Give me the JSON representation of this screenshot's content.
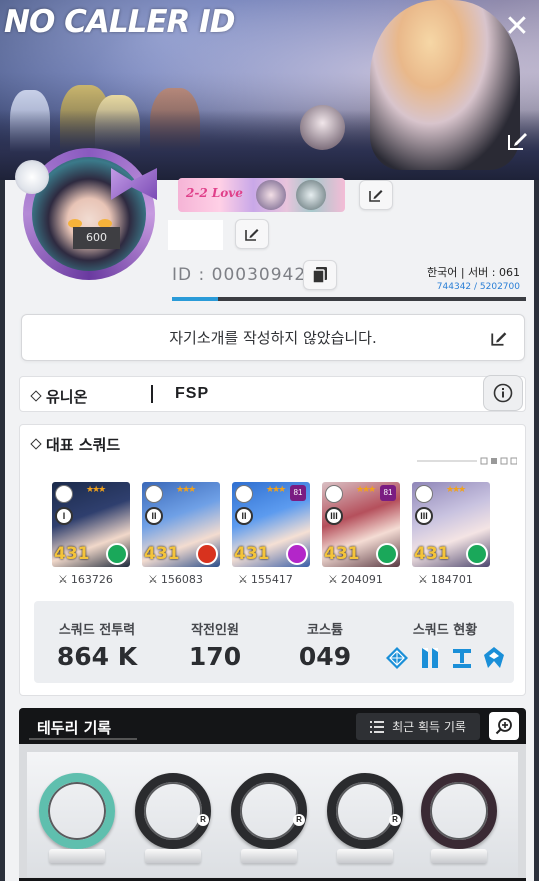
{
  "banner": {
    "title": "NO CALLER ID"
  },
  "profile": {
    "level": "600",
    "title_badge_text": "2-2 Love",
    "id_text": "ID : 00030942",
    "region_server": "한국어 | 서버 : 061",
    "server_count": "744342 / 5202700",
    "id_progress": 0.13,
    "intro_placeholder": "자기소개를 작성하지 않았습니다."
  },
  "union": {
    "label": "유니온",
    "name": "FSP"
  },
  "squad": {
    "label": "대표 스쿼드",
    "cards": [
      {
        "rank": "I",
        "level": "431",
        "elem_color": "#1aa85a",
        "power": "163726",
        "art": "linear-gradient(160deg,#1b2a4a 0%,#2f3f6e 40%,#f1d8ca 70%,#1e2a3c 100%)",
        "tag": ""
      },
      {
        "rank": "II",
        "level": "431",
        "elem_color": "#d8321e",
        "power": "156083",
        "art": "linear-gradient(160deg,#3a68b8 0%,#6fa0e6 40%,#f3dcd0 70%,#2c4e8a 100%)",
        "tag": ""
      },
      {
        "rank": "II",
        "level": "431",
        "elem_color": "#b326c9",
        "power": "155417",
        "art": "linear-gradient(160deg,#2f6fd0 0%,#5c9bef 40%,#f5e0d4 68%,#3b5fa8 100%)",
        "tag": "81"
      },
      {
        "rank": "III",
        "level": "431",
        "elem_color": "#1aa85a",
        "power": "204091",
        "art": "linear-gradient(160deg,#d9c0c4 0%,#b5505c 40%,#f4dcd4 65%,#5a3a44 100%)",
        "tag": "81"
      },
      {
        "rank": "III",
        "level": "431",
        "elem_color": "#1aa85a",
        "power": "184701",
        "art": "linear-gradient(160deg,#8f86b8 0%,#c9c3e0 40%,#f4e4e4 65%,#4e4870 100%)",
        "tag": ""
      }
    ],
    "stats": {
      "power_label": "스쿼드 전투력",
      "power_value": "864 K",
      "ops_label": "작전인원",
      "ops_value": "170",
      "costume_label": "코스튬",
      "costume_value": "049",
      "status_label": "스쿼드 현황"
    },
    "status_icons": [
      "diamond-grid-icon",
      "dual-bar-icon",
      "t-bar-icon",
      "crest-icon"
    ],
    "accent": "#1a8fd8"
  },
  "records": {
    "title": "테두리 기록",
    "recent_label": "최근 획득 기록",
    "rings": [
      {
        "name": "jade-ring",
        "color": "#5fbfae",
        "mark": ""
      },
      {
        "name": "black-ring",
        "color": "#2a2b2e",
        "mark": "R"
      },
      {
        "name": "orange-black-ring",
        "color": "#2a2b2e",
        "mark": "R"
      },
      {
        "name": "spiked-black-ring",
        "color": "#2a2b2e",
        "mark": "R"
      },
      {
        "name": "pink-black-ring",
        "color": "#3a2a34",
        "mark": ""
      }
    ]
  }
}
